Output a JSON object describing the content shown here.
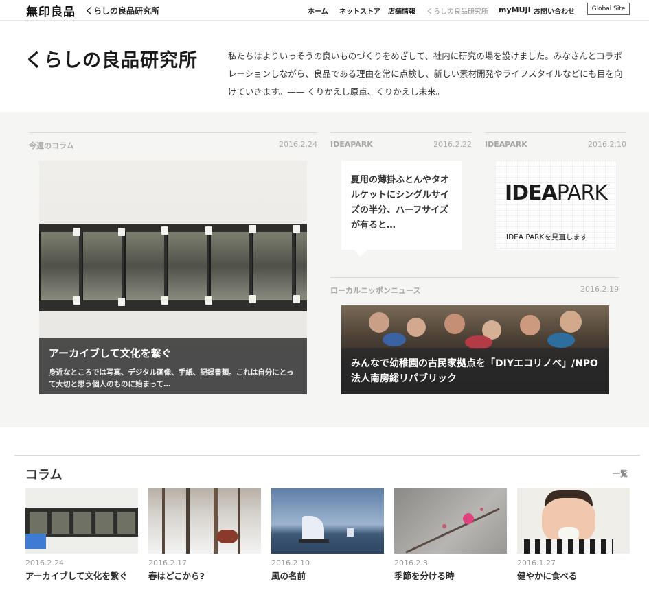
{
  "header": {
    "brand": "無印良品",
    "subbrand": "くらしの良品研究所",
    "nav": [
      "ホーム",
      "ネットストア",
      "店舗情報",
      "くらしの良品研究所",
      "myMUJI",
      "お問い合わせ"
    ],
    "global_site": "Global Site"
  },
  "intro": {
    "title": "くらしの良品研究所",
    "text": "私たちはよりいっそうの良いものづくりをめざして、社内に研究の場を設けました。みなさんとコラボレーションしながら、良品である理由を常に点検し、新しい素材開発やライフスタイルなどにも目を向けていきます。—— くりかえし原点、くりかえし未来。"
  },
  "featured": {
    "column": {
      "label": "今週のコラム",
      "date": "2016.2.24",
      "title": "アーカイブして文化を繋ぐ",
      "description": "身近なところでは写真、デジタル画像、手紙、記録書類。これは自分にとって大切と思う個人のものに始まって…"
    },
    "ideapark1": {
      "label": "IDEAPARK",
      "date": "2016.2.22",
      "text": "夏用の薄掛ふとんやタオルケットにシングルサイズの半分、ハーフサイズが有ると…"
    },
    "ideapark2": {
      "label": "IDEAPARK",
      "date": "2016.2.10",
      "logo_bold": "IDEA",
      "logo_light": "PARK",
      "caption": "IDEA PARKを見直します"
    },
    "local": {
      "label": "ローカルニッポンニュース",
      "date": "2016.2.19",
      "title": "みんなで幼稚園の古民家拠点を「DIYエコリノベ」/NPO法人南房総リパブリック"
    }
  },
  "columns": {
    "heading": "コラム",
    "more": "一覧",
    "items": [
      {
        "date": "2016.2.24",
        "title": "アーカイブして文化を繋ぐ"
      },
      {
        "date": "2016.2.17",
        "title": "春はどこから?"
      },
      {
        "date": "2016.2.10",
        "title": "風の名前"
      },
      {
        "date": "2016.2.3",
        "title": "季節を分ける時"
      },
      {
        "date": "2016.1.27",
        "title": "健やかに食べる"
      }
    ]
  }
}
